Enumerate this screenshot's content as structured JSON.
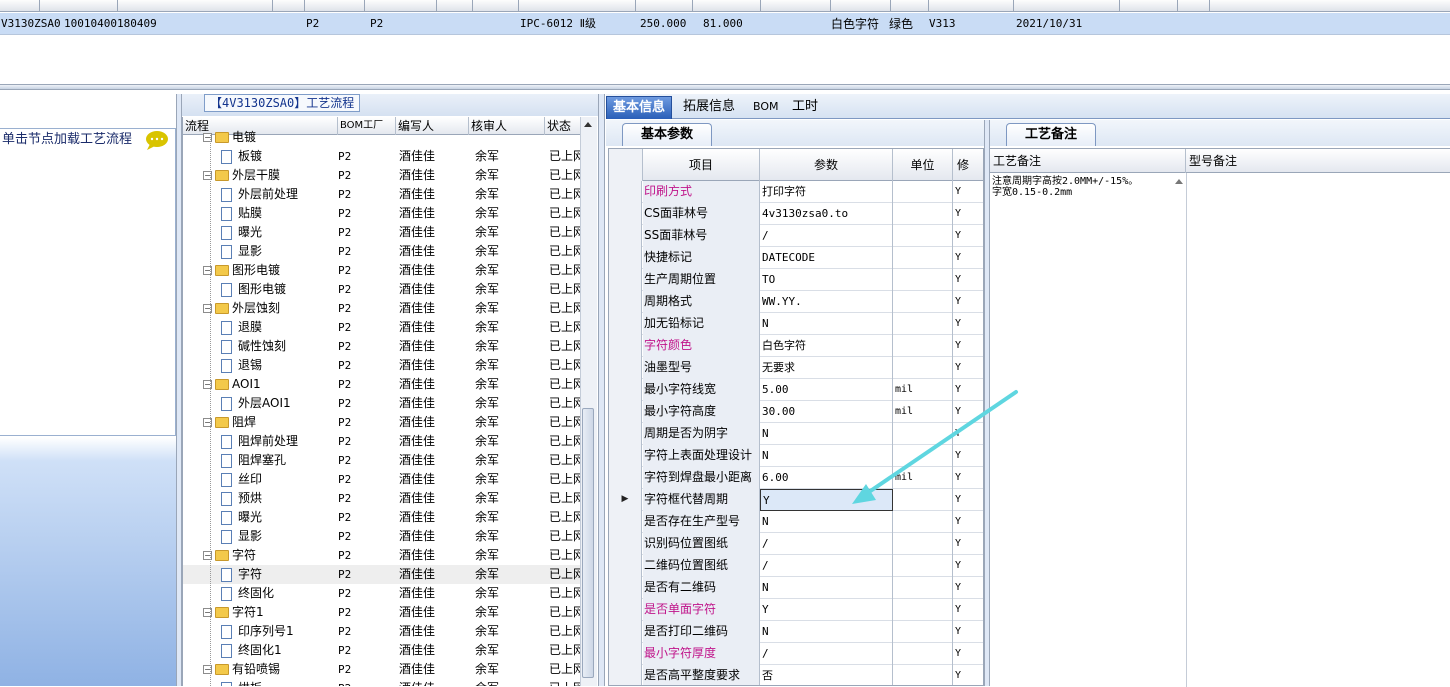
{
  "top_grid": {
    "row": [
      "V3130ZSA0",
      "10010400180409",
      "P2",
      "P2",
      "IPC-6012 Ⅱ级",
      "250.000",
      "81.000",
      "白色字符",
      "绿色",
      "V313",
      "2021/10/31"
    ]
  },
  "left_panel": {
    "tip": "单击节点加载工艺流程"
  },
  "tree": {
    "title": "【4V3130ZSA0】工艺流程",
    "headers": {
      "flow": "流程",
      "factory": "BOM工厂",
      "writer": "编写人",
      "reviewer": "核审人",
      "status": "状态"
    },
    "rows": [
      {
        "name": "电镀",
        "level": 0,
        "factory": "",
        "writer": "",
        "reviewer": "",
        "status": ""
      },
      {
        "name": "板镀",
        "level": 1,
        "factory": "P2",
        "writer": "酒佳佳",
        "reviewer": "余军",
        "status": "已上网"
      },
      {
        "name": "外层干膜",
        "level": 0,
        "factory": "P2",
        "writer": "酒佳佳",
        "reviewer": "余军",
        "status": "已上网"
      },
      {
        "name": "外层前处理",
        "level": 1,
        "factory": "P2",
        "writer": "酒佳佳",
        "reviewer": "余军",
        "status": "已上网"
      },
      {
        "name": "贴膜",
        "level": 1,
        "factory": "P2",
        "writer": "酒佳佳",
        "reviewer": "余军",
        "status": "已上网"
      },
      {
        "name": "曝光",
        "level": 1,
        "factory": "P2",
        "writer": "酒佳佳",
        "reviewer": "余军",
        "status": "已上网"
      },
      {
        "name": "显影",
        "level": 1,
        "factory": "P2",
        "writer": "酒佳佳",
        "reviewer": "余军",
        "status": "已上网"
      },
      {
        "name": "图形电镀",
        "level": 0,
        "factory": "P2",
        "writer": "酒佳佳",
        "reviewer": "余军",
        "status": "已上网"
      },
      {
        "name": "图形电镀",
        "level": 1,
        "factory": "P2",
        "writer": "酒佳佳",
        "reviewer": "余军",
        "status": "已上网"
      },
      {
        "name": "外层蚀刻",
        "level": 0,
        "factory": "P2",
        "writer": "酒佳佳",
        "reviewer": "余军",
        "status": "已上网"
      },
      {
        "name": "退膜",
        "level": 1,
        "factory": "P2",
        "writer": "酒佳佳",
        "reviewer": "余军",
        "status": "已上网"
      },
      {
        "name": "碱性蚀刻",
        "level": 1,
        "factory": "P2",
        "writer": "酒佳佳",
        "reviewer": "余军",
        "status": "已上网"
      },
      {
        "name": "退锡",
        "level": 1,
        "factory": "P2",
        "writer": "酒佳佳",
        "reviewer": "余军",
        "status": "已上网"
      },
      {
        "name": "AOI1",
        "level": 0,
        "factory": "P2",
        "writer": "酒佳佳",
        "reviewer": "余军",
        "status": "已上网"
      },
      {
        "name": "外层AOI1",
        "level": 1,
        "factory": "P2",
        "writer": "酒佳佳",
        "reviewer": "余军",
        "status": "已上网"
      },
      {
        "name": "阻焊",
        "level": 0,
        "factory": "P2",
        "writer": "酒佳佳",
        "reviewer": "余军",
        "status": "已上网"
      },
      {
        "name": "阻焊前处理",
        "level": 1,
        "factory": "P2",
        "writer": "酒佳佳",
        "reviewer": "余军",
        "status": "已上网"
      },
      {
        "name": "阻焊塞孔",
        "level": 1,
        "factory": "P2",
        "writer": "酒佳佳",
        "reviewer": "余军",
        "status": "已上网"
      },
      {
        "name": "丝印",
        "level": 1,
        "factory": "P2",
        "writer": "酒佳佳",
        "reviewer": "余军",
        "status": "已上网"
      },
      {
        "name": "预烘",
        "level": 1,
        "factory": "P2",
        "writer": "酒佳佳",
        "reviewer": "余军",
        "status": "已上网"
      },
      {
        "name": "曝光",
        "level": 1,
        "factory": "P2",
        "writer": "酒佳佳",
        "reviewer": "余军",
        "status": "已上网"
      },
      {
        "name": "显影",
        "level": 1,
        "factory": "P2",
        "writer": "酒佳佳",
        "reviewer": "余军",
        "status": "已上网"
      },
      {
        "name": "字符",
        "level": 0,
        "factory": "P2",
        "writer": "酒佳佳",
        "reviewer": "余军",
        "status": "已上网"
      },
      {
        "name": "字符",
        "level": 1,
        "factory": "P2",
        "writer": "酒佳佳",
        "reviewer": "余军",
        "status": "已上网",
        "selected": true
      },
      {
        "name": "终固化",
        "level": 1,
        "factory": "P2",
        "writer": "酒佳佳",
        "reviewer": "余军",
        "status": "已上网"
      },
      {
        "name": "字符1",
        "level": 0,
        "factory": "P2",
        "writer": "酒佳佳",
        "reviewer": "余军",
        "status": "已上网"
      },
      {
        "name": "印序列号1",
        "level": 1,
        "factory": "P2",
        "writer": "酒佳佳",
        "reviewer": "余军",
        "status": "已上网"
      },
      {
        "name": "终固化1",
        "level": 1,
        "factory": "P2",
        "writer": "酒佳佳",
        "reviewer": "余军",
        "status": "已上网"
      },
      {
        "name": "有铅喷锡",
        "level": 0,
        "factory": "P2",
        "writer": "酒佳佳",
        "reviewer": "余军",
        "status": "已上网"
      },
      {
        "name": "烘板",
        "level": 1,
        "factory": "P2",
        "writer": "酒佳佳",
        "reviewer": "余军",
        "status": "已上网"
      }
    ]
  },
  "tabs": [
    "基本信息",
    "拓展信息",
    "BOM",
    "工时"
  ],
  "basic": {
    "sub_tab": "基本参数",
    "headers": {
      "item": "项目",
      "param": "参数",
      "unit": "单位",
      "mod": "修"
    },
    "rows": [
      {
        "item": "印刷方式",
        "value": "打印字符",
        "unit": "",
        "mod": "Y",
        "highlight": true
      },
      {
        "item": "CS面菲林号",
        "value": "4v3130zsa0.to",
        "unit": "",
        "mod": "Y"
      },
      {
        "item": "SS面菲林号",
        "value": "/",
        "unit": "",
        "mod": "Y"
      },
      {
        "item": "快捷标记",
        "value": "DATECODE",
        "unit": "",
        "mod": "Y"
      },
      {
        "item": "生产周期位置",
        "value": "TO",
        "unit": "",
        "mod": "Y"
      },
      {
        "item": "周期格式",
        "value": "WW.YY.",
        "unit": "",
        "mod": "Y"
      },
      {
        "item": "加无铅标记",
        "value": "N",
        "unit": "",
        "mod": "Y"
      },
      {
        "item": "字符颜色",
        "value": "白色字符",
        "unit": "",
        "mod": "Y",
        "highlight": true
      },
      {
        "item": "油墨型号",
        "value": "无要求",
        "unit": "",
        "mod": "Y"
      },
      {
        "item": "最小字符线宽",
        "value": "5.00",
        "unit": "mil",
        "mod": "Y"
      },
      {
        "item": "最小字符高度",
        "value": "30.00",
        "unit": "mil",
        "mod": "Y"
      },
      {
        "item": "周期是否为阴字",
        "value": "N",
        "unit": "",
        "mod": "Y"
      },
      {
        "item": "字符上表面处理设计",
        "value": "N",
        "unit": "",
        "mod": "Y"
      },
      {
        "item": "字符到焊盘最小距离",
        "value": "6.00",
        "unit": "mil",
        "mod": "Y"
      },
      {
        "item": "字符框代替周期",
        "value": "Y",
        "unit": "",
        "mod": "Y",
        "current": true
      },
      {
        "item": "是否存在生产型号",
        "value": "N",
        "unit": "",
        "mod": "Y"
      },
      {
        "item": "识别码位置图纸",
        "value": "/",
        "unit": "",
        "mod": "Y"
      },
      {
        "item": "二维码位置图纸",
        "value": "/",
        "unit": "",
        "mod": "Y"
      },
      {
        "item": "是否有二维码",
        "value": "N",
        "unit": "",
        "mod": "Y"
      },
      {
        "item": "是否单面字符",
        "value": "Y",
        "unit": "",
        "mod": "Y",
        "highlight": true
      },
      {
        "item": "是否打印二维码",
        "value": "N",
        "unit": "",
        "mod": "Y"
      },
      {
        "item": "最小字符厚度",
        "value": "/",
        "unit": "",
        "mod": "Y",
        "highlight": true
      },
      {
        "item": "是否高平整度要求",
        "value": "否",
        "unit": "",
        "mod": "Y"
      }
    ]
  },
  "notes": {
    "tab": "工艺备注",
    "col1": "工艺备注",
    "col2": "型号备注",
    "text": "注意周期字高按2.0MM+/-15%。\n字宽0.15-0.2mm"
  },
  "colors": {
    "accent": "#2a5fb8",
    "highlight_text": "#c0148a",
    "arrow": "#5fd6e0"
  }
}
